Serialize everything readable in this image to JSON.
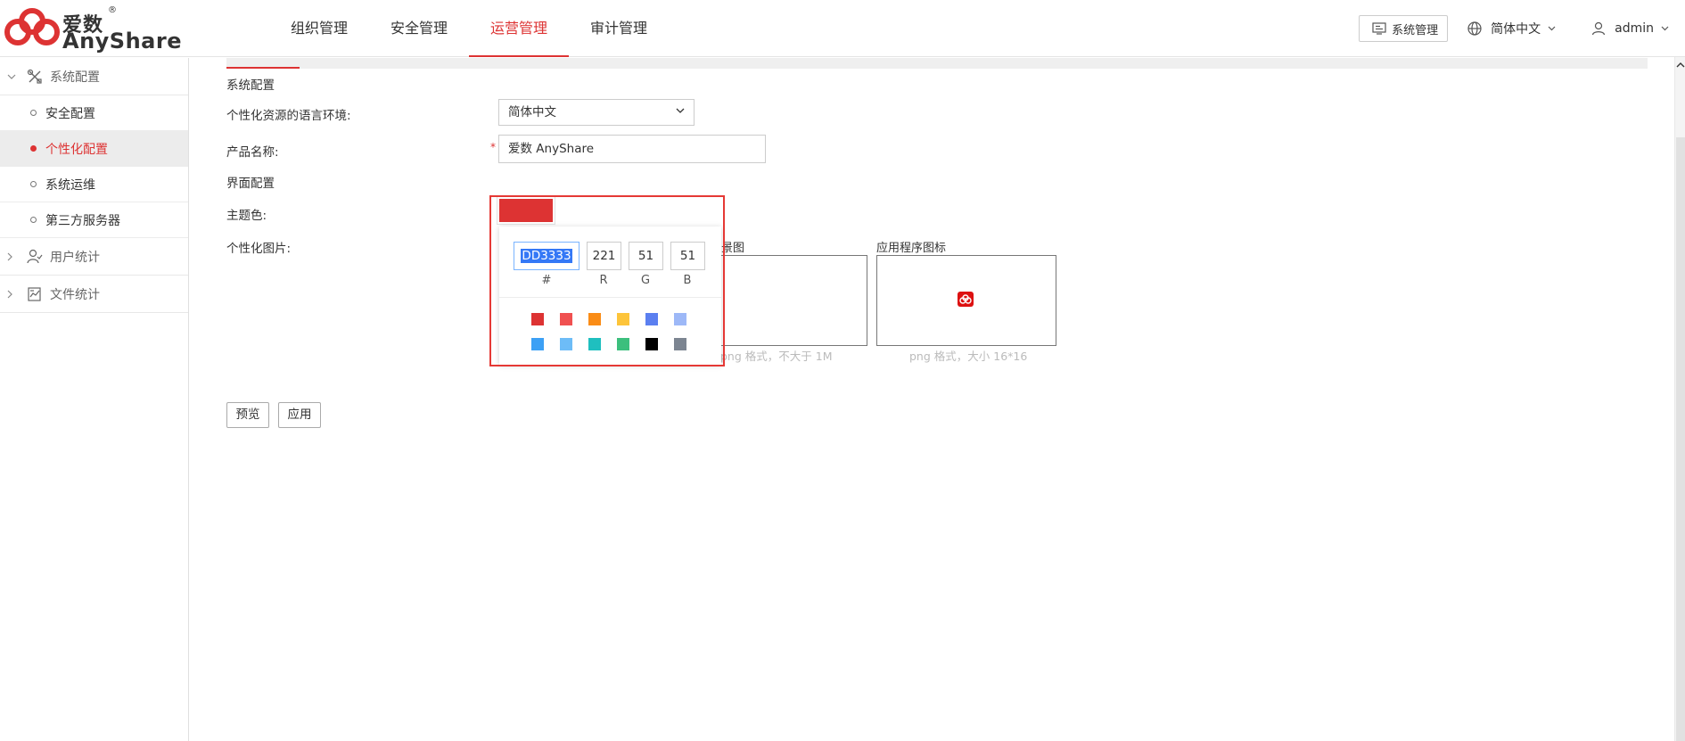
{
  "brand": {
    "name_cn": "爱数",
    "name_en": "AnyShare",
    "reg_mark": "®",
    "color": "#dd3333"
  },
  "nav": {
    "items": [
      {
        "label": "组织管理",
        "active": false
      },
      {
        "label": "安全管理",
        "active": false
      },
      {
        "label": "运营管理",
        "active": true
      },
      {
        "label": "审计管理",
        "active": false
      }
    ]
  },
  "header_right": {
    "system_button": "系统管理",
    "language": "简体中文",
    "user": "admin"
  },
  "sidebar": {
    "groups": [
      {
        "label": "系统配置",
        "icon": "tools-icon",
        "expanded": true,
        "items": [
          {
            "label": "安全配置",
            "active": false
          },
          {
            "label": "个性化配置",
            "active": true
          },
          {
            "label": "系统运维",
            "active": false
          },
          {
            "label": "第三方服务器",
            "active": false
          }
        ]
      },
      {
        "label": "用户统计",
        "icon": "user-stats-icon",
        "expanded": false
      },
      {
        "label": "文件统计",
        "icon": "file-stats-icon",
        "expanded": false
      }
    ]
  },
  "form": {
    "section_system": "系统配置",
    "lang_label": "个性化资源的语言环境:",
    "lang_value": "简体中文",
    "product_label": "产品名称:",
    "product_required": "*",
    "product_value": "爱数 AnyShare",
    "section_ui": "界面配置",
    "theme_label": "主题色:",
    "theme_color": "#dd3333",
    "images_label": "个性化图片:",
    "bg_image_caption_partial": "景图",
    "bg_image_hint_partial": "png 格式，不大于 1M",
    "app_icon_caption": "应用程序图标",
    "app_icon_hint": "png 格式，大小 16*16",
    "preview_button": "预览",
    "apply_button": "应用"
  },
  "color_picker": {
    "hex": "DD3333",
    "r": "221",
    "g": "51",
    "b": "51",
    "hex_label": "#",
    "r_label": "R",
    "g_label": "G",
    "b_label": "B",
    "swatches": [
      "#dd3333",
      "#f05050",
      "#fa8c16",
      "#fdc43a",
      "#5b7ff0",
      "#9db8f7",
      "#3ca0f5",
      "#6dbcf7",
      "#1fbfbf",
      "#3cbf7d",
      "#000000",
      "#7c8591"
    ]
  }
}
